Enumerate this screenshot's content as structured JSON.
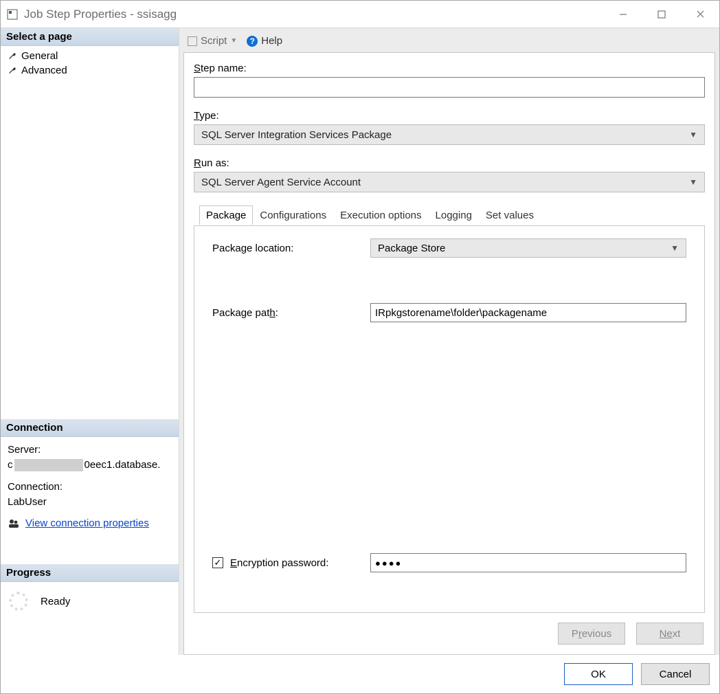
{
  "window": {
    "title": "Job Step Properties - ssisagg"
  },
  "sidebar": {
    "select_page_header": "Select a page",
    "items": [
      {
        "label": "General"
      },
      {
        "label": "Advanced"
      }
    ],
    "connection_header": "Connection",
    "server_label": "Server:",
    "server_prefix": "c",
    "server_suffix": "0eec1.database.",
    "connection_label": "Connection:",
    "connection_value": "LabUser",
    "view_conn_link": "View connection properties",
    "progress_header": "Progress",
    "progress_status": "Ready"
  },
  "toolbar": {
    "script_label": "Script",
    "help_label": "Help"
  },
  "form": {
    "step_name_label_pre": "S",
    "step_name_label_rest": "tep name:",
    "step_name_value": "",
    "type_label_pre": "T",
    "type_label_rest": "ype:",
    "type_value": "SQL Server Integration Services Package",
    "runas_label_pre": "R",
    "runas_label_rest": "un as:",
    "runas_value": "SQL Server Agent Service Account"
  },
  "tabs": {
    "items": [
      "Package",
      "Configurations",
      "Execution options",
      "Logging",
      "Set values"
    ],
    "active_index": 0
  },
  "package": {
    "location_label": "Package location:",
    "location_value": "Package Store",
    "path_label_pre": "Package pat",
    "path_label_u": "h",
    "path_label_post": ":",
    "path_value": "IRpkgstorename\\folder\\packagename",
    "enc_label_pre": "E",
    "enc_label_rest": "ncryption password:",
    "enc_checked": true,
    "enc_value_masked": "●●●●"
  },
  "wizard": {
    "previous_pre": "P",
    "previous_u": "r",
    "previous_post": "evious",
    "next_pre": "N",
    "next_u": "e",
    "next_post": "xt"
  },
  "footer": {
    "ok": "OK",
    "cancel": "Cancel"
  }
}
